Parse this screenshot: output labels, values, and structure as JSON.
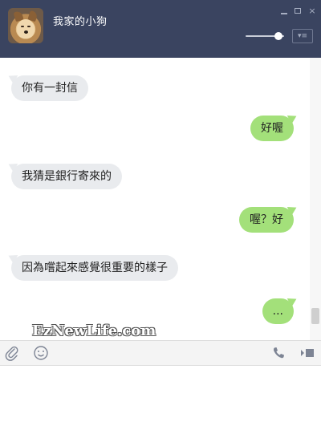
{
  "window": {
    "title": "我家的小狗",
    "close_glyph": "×",
    "menu_glyph": "▾≡",
    "volume_level": 0.85
  },
  "messages": [
    {
      "side": "in",
      "text": "你有一封信"
    },
    {
      "side": "out",
      "text": "好喔"
    },
    {
      "side": "in",
      "text": "我猜是銀行寄來的"
    },
    {
      "side": "out",
      "text": "喔？好"
    },
    {
      "side": "in",
      "text": "因為嚐起來感覺很重要的樣子"
    },
    {
      "side": "out",
      "text": "..."
    }
  ],
  "watermark": "EzNewLife.com",
  "toolbar": {
    "left_icons": [
      "paperclip-icon",
      "emoji-icon"
    ],
    "right_icons": [
      "phone-icon",
      "video-icon"
    ]
  },
  "colors": {
    "titlebar": "#3a4460",
    "incoming_bubble": "#e9ebee",
    "outgoing_bubble": "#a3e07a"
  }
}
